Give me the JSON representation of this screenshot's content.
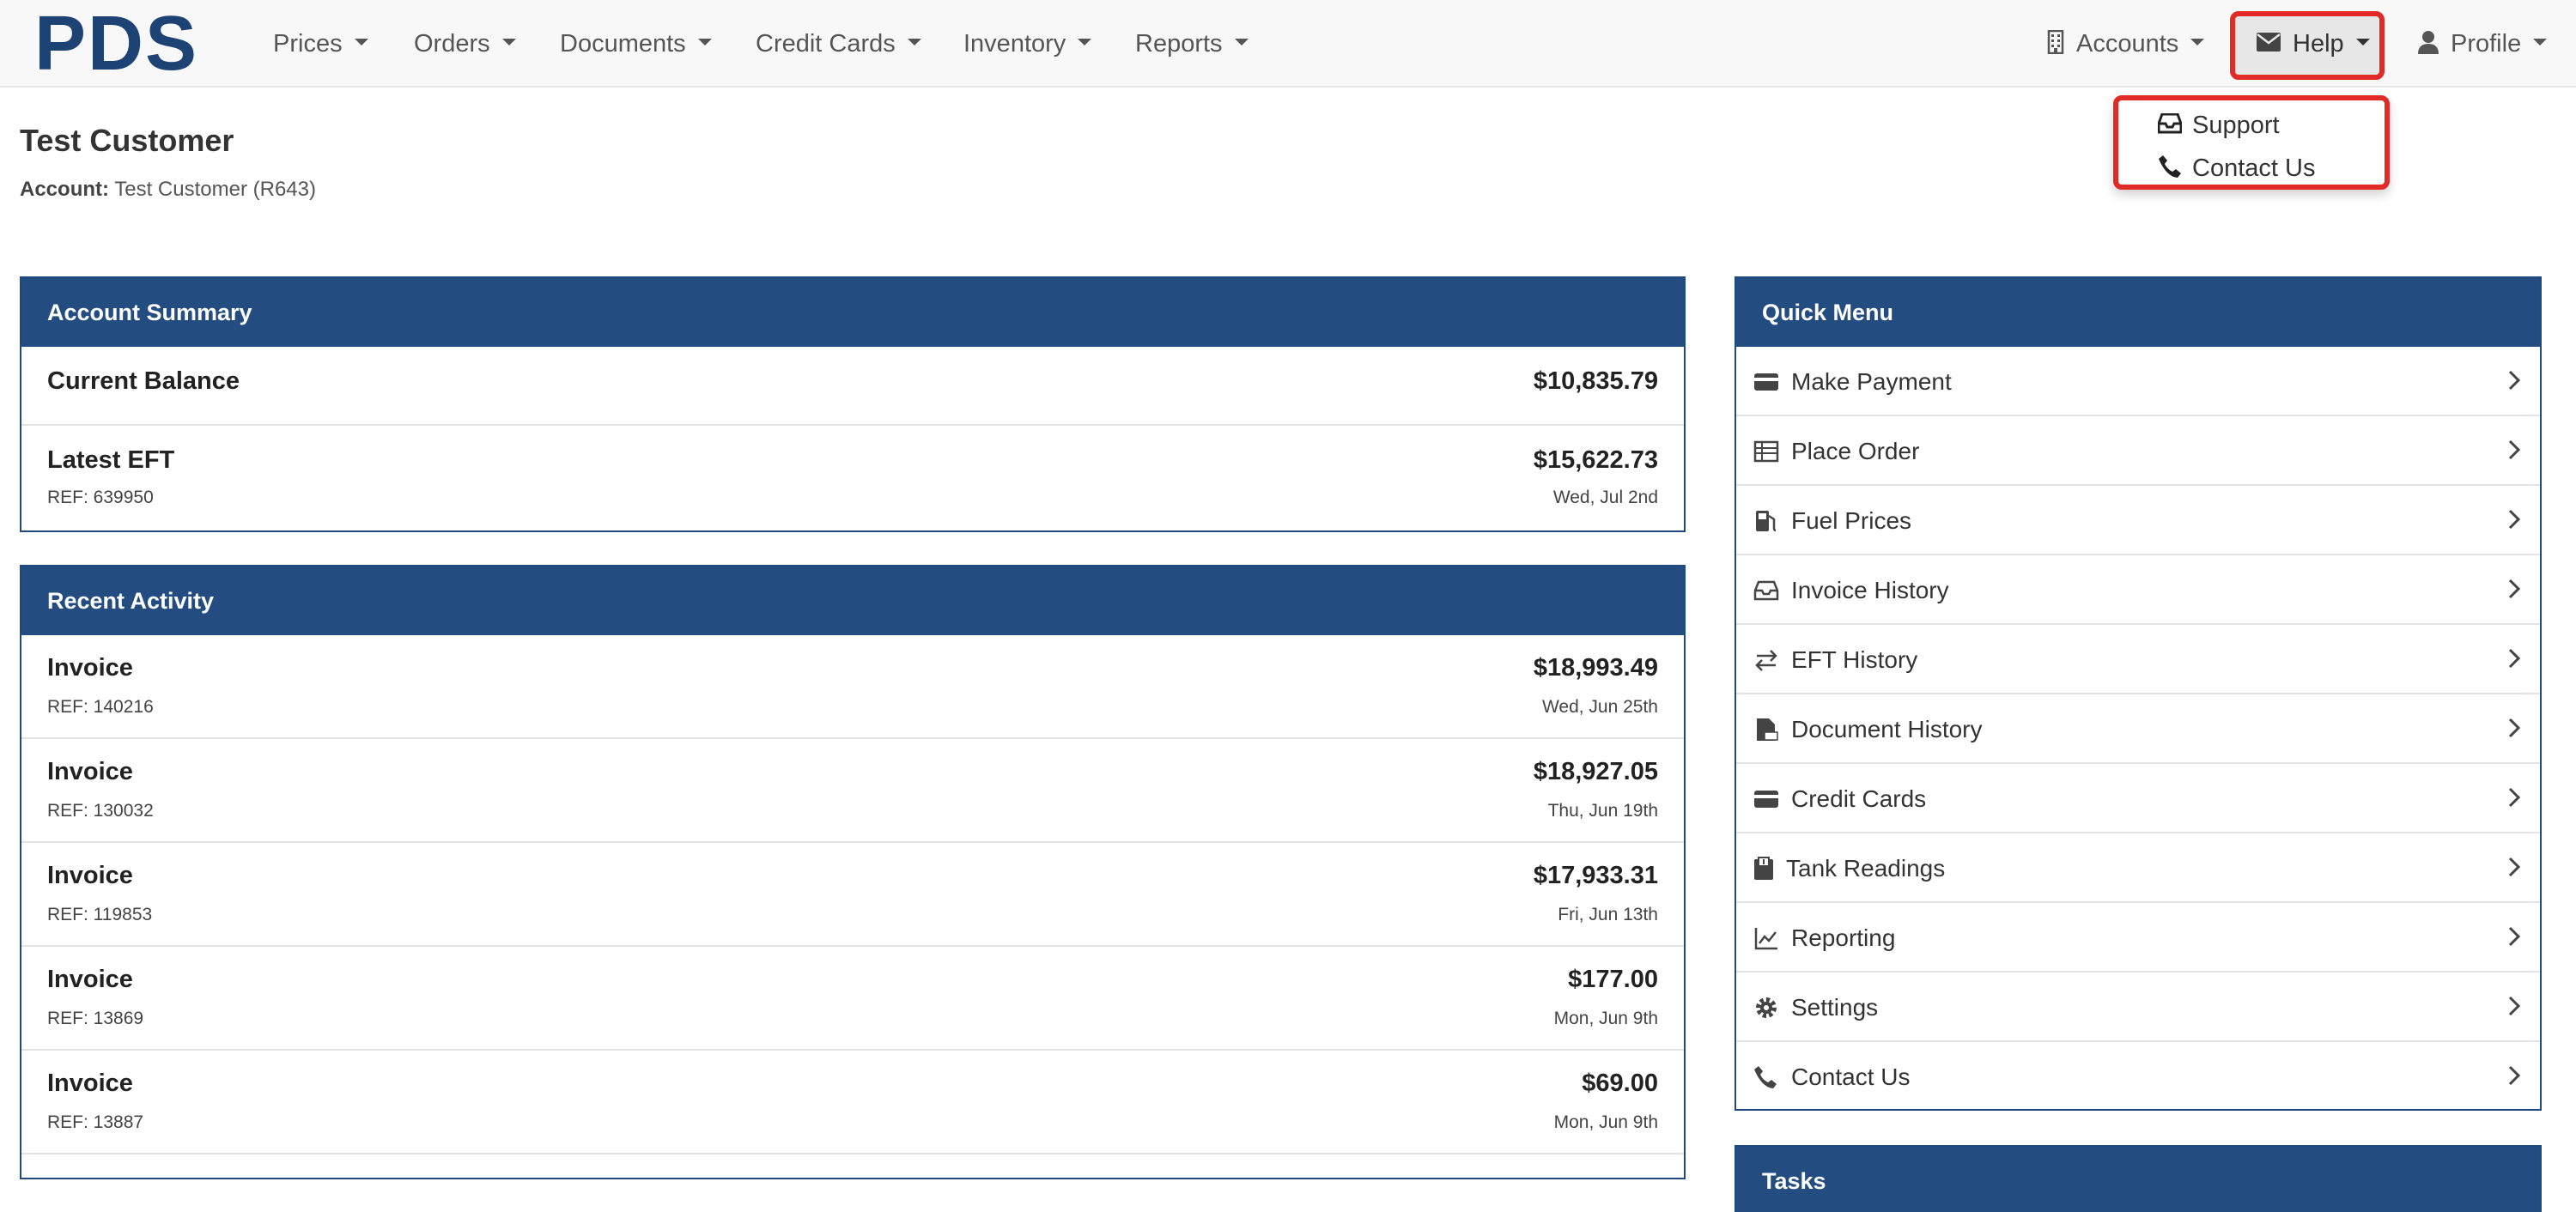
{
  "nav": {
    "logo": "PDS",
    "items": [
      {
        "label": "Prices"
      },
      {
        "label": "Orders"
      },
      {
        "label": "Documents"
      },
      {
        "label": "Credit Cards"
      },
      {
        "label": "Inventory"
      },
      {
        "label": "Reports"
      }
    ],
    "right": {
      "accounts": "Accounts",
      "help": "Help",
      "profile": "Profile"
    }
  },
  "help_menu": {
    "items": [
      {
        "label": "Support",
        "icon": "inbox-icon"
      },
      {
        "label": "Contact Us",
        "icon": "phone-icon"
      }
    ]
  },
  "customer": {
    "name": "Test Customer",
    "account_label": "Account:",
    "account_value": "Test Customer (R643)"
  },
  "account_summary": {
    "title": "Account Summary",
    "current_balance_label": "Current Balance",
    "current_balance": "$10,835.79",
    "latest_eft_label": "Latest EFT",
    "latest_eft_amount": "$15,622.73",
    "latest_eft_ref": "REF: 639950",
    "latest_eft_date": "Wed, Jul 2nd"
  },
  "recent_activity": {
    "title": "Recent Activity",
    "rows": [
      {
        "type": "Invoice",
        "amount": "$18,993.49",
        "ref": "REF: 140216",
        "date": "Wed, Jun 25th"
      },
      {
        "type": "Invoice",
        "amount": "$18,927.05",
        "ref": "REF: 130032",
        "date": "Thu, Jun 19th"
      },
      {
        "type": "Invoice",
        "amount": "$17,933.31",
        "ref": "REF: 119853",
        "date": "Fri, Jun 13th"
      },
      {
        "type": "Invoice",
        "amount": "$177.00",
        "ref": "REF: 13869",
        "date": "Mon, Jun 9th"
      },
      {
        "type": "Invoice",
        "amount": "$69.00",
        "ref": "REF: 13887",
        "date": "Mon, Jun 9th"
      }
    ]
  },
  "quick_menu": {
    "title": "Quick Menu",
    "items": [
      {
        "label": "Make Payment",
        "icon": "credit-card-icon"
      },
      {
        "label": "Place Order",
        "icon": "table-icon"
      },
      {
        "label": "Fuel Prices",
        "icon": "gas-pump-icon"
      },
      {
        "label": "Invoice History",
        "icon": "inbox-icon"
      },
      {
        "label": "EFT History",
        "icon": "exchange-icon"
      },
      {
        "label": "Document History",
        "icon": "pdf-file-icon"
      },
      {
        "label": "Credit Cards",
        "icon": "credit-card-icon"
      },
      {
        "label": "Tank Readings",
        "icon": "tank-gauge-icon"
      },
      {
        "label": "Reporting",
        "icon": "line-chart-icon"
      },
      {
        "label": "Settings",
        "icon": "gear-icon"
      },
      {
        "label": "Contact Us",
        "icon": "phone-icon"
      }
    ]
  },
  "tasks": {
    "title": "Tasks"
  },
  "colors": {
    "brand": "#1d4375",
    "panel_header": "#234c80",
    "highlight": "#e02b27"
  }
}
